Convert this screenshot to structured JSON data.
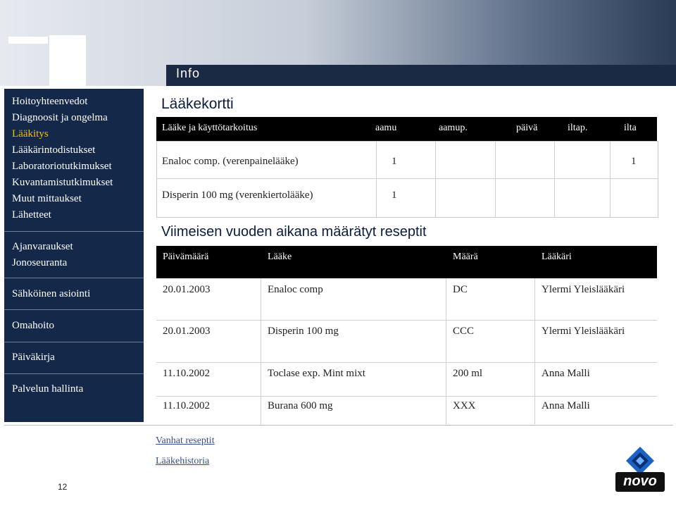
{
  "header": {
    "title": "Info"
  },
  "sidebar": {
    "items": [
      {
        "label": "Hoitoyhteenvedot",
        "active": false
      },
      {
        "label": "Diagnoosit ja ongelma",
        "active": false
      },
      {
        "label": "Lääkitys",
        "active": true
      },
      {
        "label": "Lääkärintodistukset",
        "active": false
      },
      {
        "label": "Laboratoriotutkimukset",
        "active": false
      },
      {
        "label": "Kuvantamistutkimukset",
        "active": false
      },
      {
        "label": "Muut mittaukset",
        "active": false
      },
      {
        "label": "Lähetteet",
        "active": false
      },
      {
        "label": "Ajanvaraukset",
        "active": false
      },
      {
        "label": "Jonoseuranta",
        "active": false
      },
      {
        "label": "Sähköinen asiointi",
        "active": false
      },
      {
        "label": "Omahoito",
        "active": false
      },
      {
        "label": "Päiväkirja",
        "active": false
      },
      {
        "label": "Palvelun hallinta",
        "active": false
      }
    ]
  },
  "medication_card": {
    "title": "Lääkekortti",
    "columns": [
      "Lääke ja käyttötarkoitus",
      "aamu",
      "aamup.",
      "päivä",
      "iltap.",
      "ilta"
    ],
    "rows": [
      {
        "drug": "Enaloc comp. (verenpainelääke)",
        "aamu": "1",
        "aamup": "",
        "paiva": "",
        "iltap": "",
        "ilta": "1"
      },
      {
        "drug": "Disperin 100 mg (verenkiertolääke)",
        "aamu": "1",
        "aamup": "",
        "paiva": "",
        "iltap": "",
        "ilta": ""
      }
    ]
  },
  "prescriptions": {
    "title": "Viimeisen vuoden aikana määrätyt reseptit",
    "columns": [
      "Päivämäärä",
      "Lääke",
      "Määrä",
      "Lääkäri"
    ],
    "rows": [
      {
        "date": "20.01.2003",
        "drug": "Enaloc comp",
        "amount": "DC",
        "doctor": "Ylermi Yleislääkäri"
      },
      {
        "date": "20.01.2003",
        "drug": "Disperin 100 mg",
        "amount": "CCC",
        "doctor": "Ylermi Yleislääkäri"
      },
      {
        "date": "11.10.2002",
        "drug": "Toclase exp. Mint mixt",
        "amount": "200 ml",
        "doctor": "Anna Malli"
      },
      {
        "date": "11.10.2002",
        "drug": "Burana 600 mg",
        "amount": "XXX",
        "doctor": "Anna Malli"
      }
    ]
  },
  "links": {
    "old_prescriptions": "Vanhat reseptit",
    "drug_history": "Lääkehistoria"
  },
  "footer": {
    "page_number": "12"
  },
  "logo": {
    "text": "novo"
  },
  "colors": {
    "nav_bg": "#14284a",
    "active": "#f1c400",
    "header_band": "#1a2a44"
  }
}
